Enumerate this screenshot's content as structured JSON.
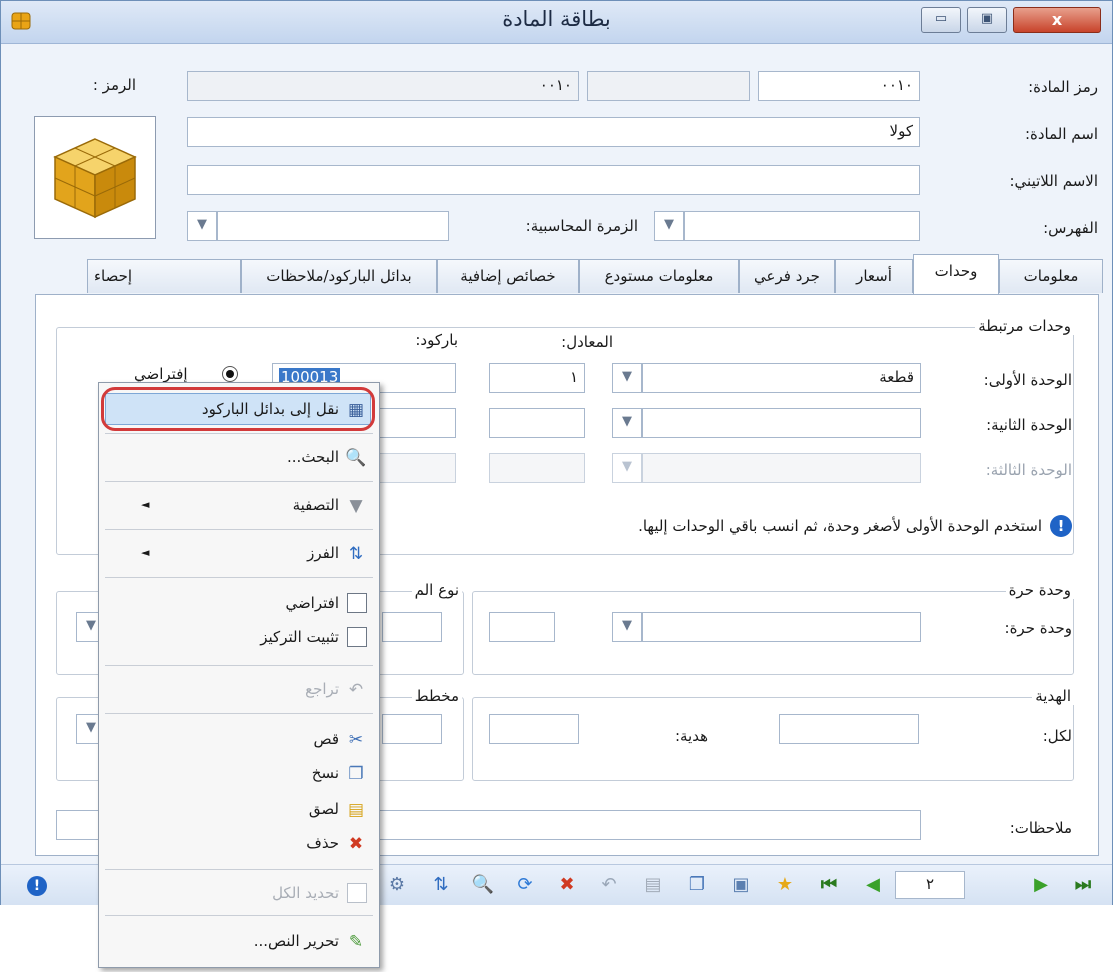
{
  "window": {
    "title": "بطاقة المادة",
    "close_glyph": "x",
    "minimize_glyph": "▭",
    "maximize_glyph": "▣"
  },
  "header": {
    "code_label": "رمز المادة:",
    "code_value": "٠٠١٠",
    "code_secondary_value": "",
    "code2_value": "٠٠١٠",
    "symbol_label": "الرمز :",
    "name_label": "اسم المادة:",
    "name_value": "كولا",
    "latin_label": "الاسم اللاتيني:",
    "latin_value": "",
    "index_label": "الفهرس:",
    "index_value": "",
    "account_group_label": "الزمرة المحاسبية:",
    "account_group_value": ""
  },
  "tabs": [
    "معلومات",
    "وحدات",
    "أسعار",
    "جرد فرعي",
    "معلومات مستودع",
    "خصائص إضافية",
    "بدائل الباركود/ملاحظات",
    "إحصاء"
  ],
  "units": {
    "group_title": "وحدات مرتبطة",
    "equiv_header": "المعادل:",
    "barcode_header": "باركود:",
    "unit1_label": "الوحدة الأولى:",
    "unit1_value": "قطعة",
    "unit1_equiv": "١",
    "unit1_barcode": "100013",
    "default_label": "إفتراضي",
    "unit2_label": "الوحدة الثانية:",
    "unit3_label": "الوحدة الثالثة:",
    "info_text": "استخدم الوحدة الأولى لأصغر وحدة، ثم انسب باقي الوحدات إليها."
  },
  "free_unit": {
    "group_title": "وحدة حرة",
    "label": "وحدة حرة:",
    "type_group_title": "نوع الم"
  },
  "gift": {
    "group_title": "الهدية",
    "per_label": "لكل:",
    "gift_label": "هدية:",
    "plan_group_title": "مخطط"
  },
  "notes_label": "ملاحظات:",
  "toolbar": {
    "page_value": "٢"
  },
  "context_menu": {
    "move_to_barcode": "نقل إلى بدائل الباركود",
    "search": "البحث...",
    "filter": "التصفية",
    "sort": "الفرز",
    "default": "افتراضي",
    "fix_focus": "تثبيت التركيز",
    "undo": "تراجع",
    "cut": "قص",
    "copy": "نسخ",
    "paste": "لصق",
    "delete": "حذف",
    "select_all": "تحديد الكل",
    "edit_text": "تحرير النص...",
    "submenu_arrow": "◄"
  },
  "colors": {
    "highlight_ring": "#d23a3a",
    "menu_highlight": "#cfe3f7",
    "selection": "#3a78c9"
  }
}
